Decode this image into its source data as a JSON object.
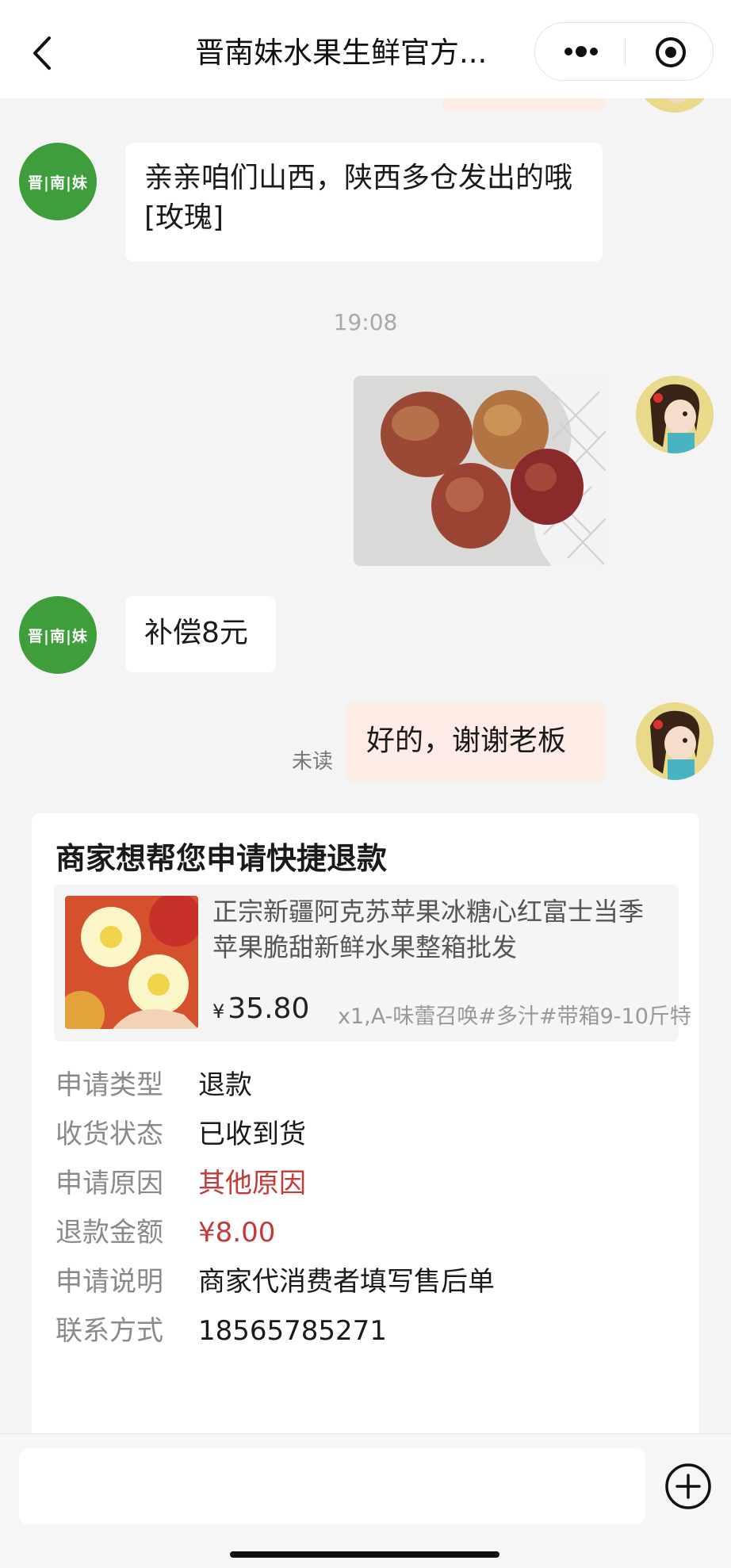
{
  "header": {
    "title": "晋南妹水果生鲜官方...",
    "back_icon": "chevron-left-icon",
    "more_icon": "more-dots-icon",
    "close_icon": "target-close-icon"
  },
  "shop_avatar_text": "晋|南|妹",
  "messages": [
    {
      "from": "shop",
      "text": "亲亲咱们山西，陕西多仓发出的哦[玫瑰]"
    },
    {
      "type": "time",
      "text": "19:08"
    },
    {
      "from": "user",
      "type": "image",
      "alt": "apples-photo"
    },
    {
      "from": "shop",
      "text": "补偿8元"
    },
    {
      "from": "user",
      "text": "好的，谢谢老板",
      "status": "未读"
    }
  ],
  "refund_card": {
    "title": "商家想帮您申请快捷退款",
    "product": {
      "name": "正宗新疆阿克苏苹果冰糖心红富士当季苹果脆甜新鲜水果整箱批发",
      "currency": "¥",
      "price": "35.80",
      "spec": "x1,A-味蕾召唤#多汁#带箱9-10斤特"
    },
    "fields": [
      {
        "label": "申请类型",
        "value": "退款"
      },
      {
        "label": "收货状态",
        "value": "已收到货"
      },
      {
        "label": "申请原因",
        "value": "其他原因",
        "highlight": true
      },
      {
        "label": "退款金额",
        "value": "¥8.00",
        "highlight": true
      },
      {
        "label": "申请说明",
        "value": "商家代消费者填写售后单"
      },
      {
        "label": "联系方式",
        "value": "18565785271"
      }
    ]
  },
  "footer": {
    "plus_icon": "plus-circle-icon"
  },
  "colors": {
    "shop_green": "#3e9e3c",
    "out_bubble": "#fdebe6",
    "highlight_red": "#c43a3a"
  }
}
